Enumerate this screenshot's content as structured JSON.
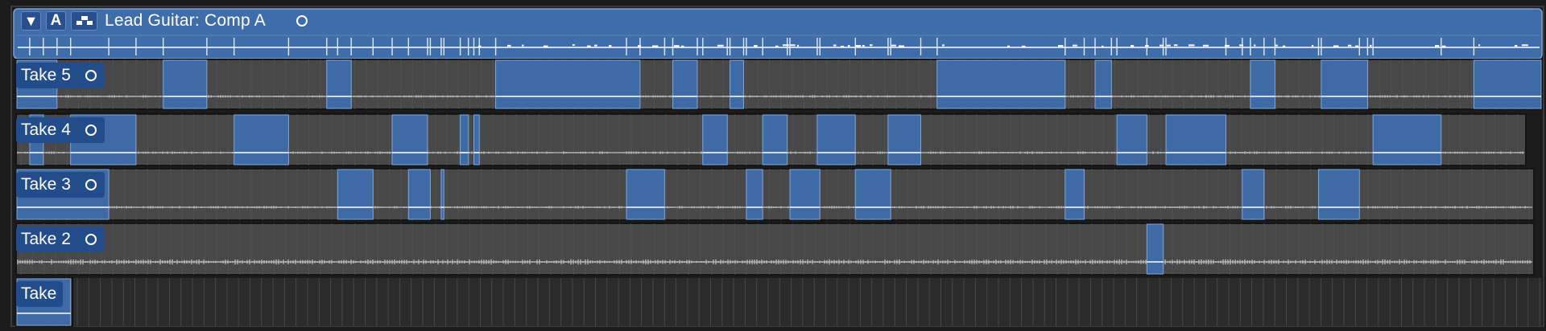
{
  "comp": {
    "title": "Lead Guitar: Comp A",
    "buttons": {
      "disclosure": "▼",
      "auto_label": "A",
      "quick_swipe_icon": "quick-swipe-comping-icon"
    }
  },
  "takes": [
    {
      "id": "take5",
      "label": "Take 5",
      "selected_ranges": [
        [
          0.0,
          1.5
        ],
        [
          5.4,
          7.0
        ],
        [
          11.4,
          12.3
        ],
        [
          17.6,
          22.9
        ],
        [
          24.1,
          25.0
        ],
        [
          26.2,
          26.7
        ],
        [
          33.8,
          38.5
        ],
        [
          39.6,
          40.2
        ],
        [
          45.3,
          46.2
        ],
        [
          47.9,
          49.6
        ],
        [
          53.5,
          56.0
        ]
      ]
    },
    {
      "id": "take4",
      "label": "Take 4",
      "selected_ranges": [
        [
          0.5,
          1.0
        ],
        [
          2.0,
          4.4
        ],
        [
          8.0,
          10.0
        ],
        [
          13.8,
          15.1
        ],
        [
          16.3,
          16.6
        ],
        [
          16.8,
          17.0
        ],
        [
          25.2,
          26.1
        ],
        [
          27.4,
          28.3
        ],
        [
          29.4,
          30.8
        ],
        [
          32.0,
          33.2
        ],
        [
          40.4,
          41.5
        ],
        [
          42.2,
          44.4
        ],
        [
          49.8,
          52.3
        ]
      ]
    },
    {
      "id": "take3",
      "label": "Take 3",
      "selected_ranges": [
        [
          0.0,
          3.4
        ],
        [
          11.8,
          13.1
        ],
        [
          14.4,
          15.2
        ],
        [
          15.6,
          15.7
        ],
        [
          22.4,
          23.8
        ],
        [
          26.8,
          27.4
        ],
        [
          28.4,
          29.5
        ],
        [
          30.8,
          32.1
        ],
        [
          38.5,
          39.2
        ],
        [
          45.0,
          45.8
        ],
        [
          47.8,
          49.3
        ]
      ]
    },
    {
      "id": "take2",
      "label": "Take 2",
      "selected_ranges": [
        [
          41.5,
          42.1
        ]
      ]
    },
    {
      "id": "take1",
      "label": "Take",
      "selected_ranges": [
        [
          0.0,
          2.0
        ]
      ]
    }
  ],
  "colors": {
    "background": "#1b1b1b",
    "comp_header": "#3f6daa",
    "comp_header_border": "#7fa0d0",
    "selection": "#3e6ba6",
    "selection_edge": "#7fa6da",
    "lane_unselected": "#484848",
    "lane_empty": "#2b2b2b",
    "label_bg": "#234c8a",
    "waveform": "#bbbbbb",
    "waveform_selected": "#ffffff",
    "text": "#ffffff"
  }
}
